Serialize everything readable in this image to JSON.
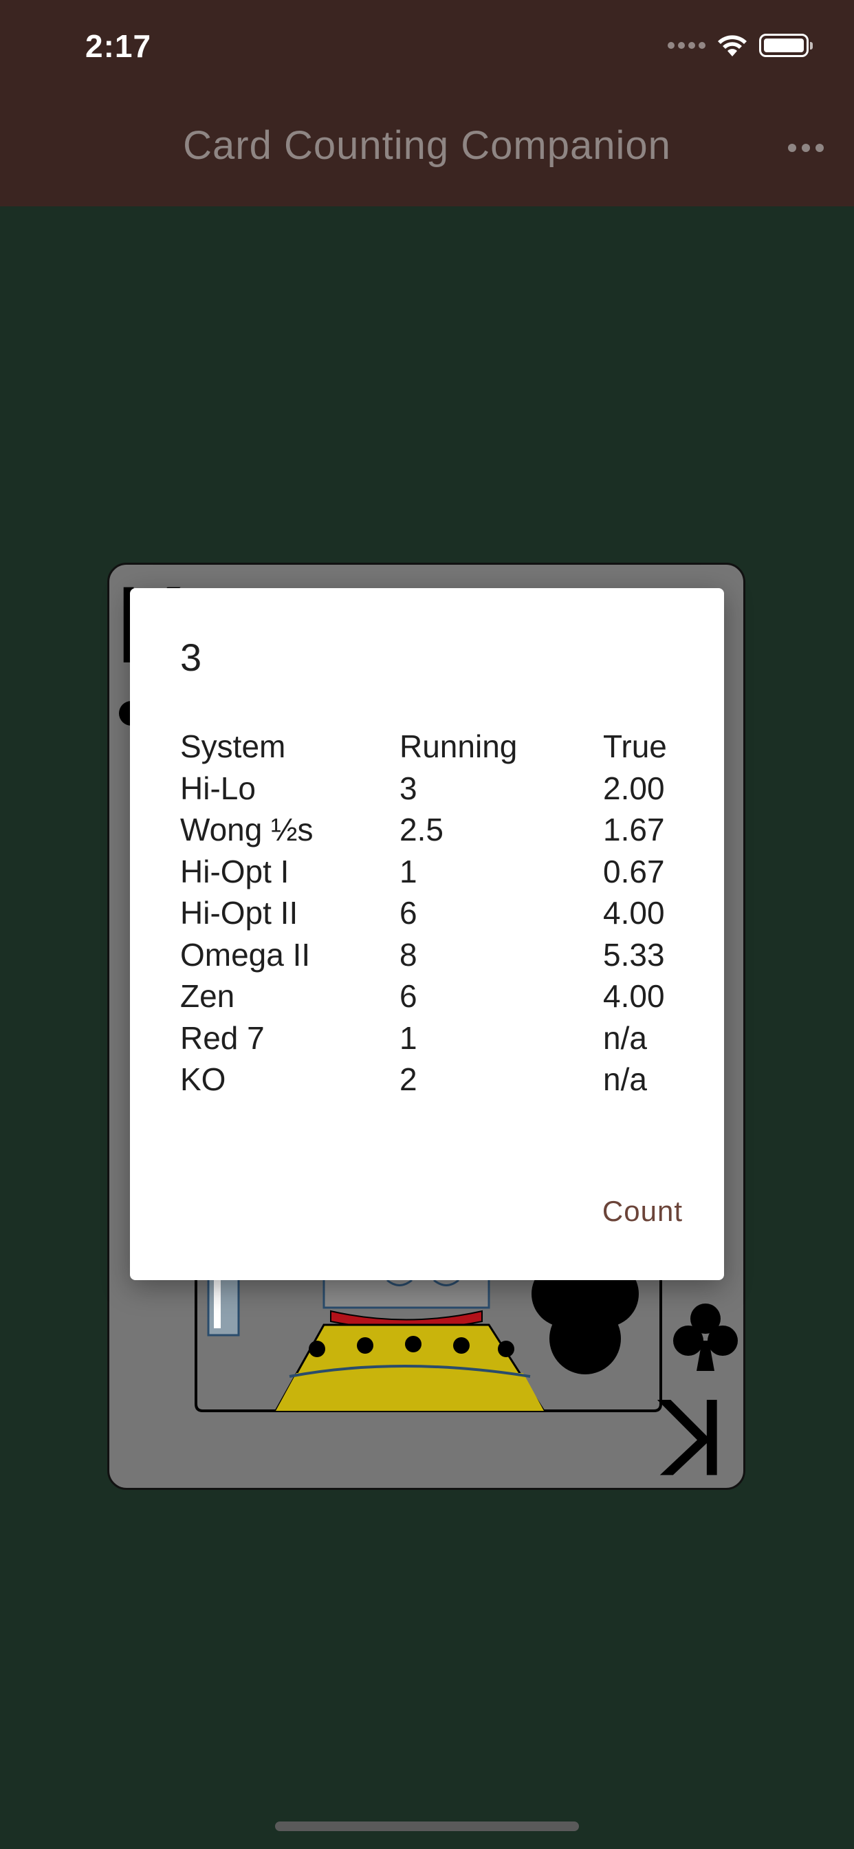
{
  "status_bar": {
    "time": "2:17"
  },
  "app_bar": {
    "title": "Card Counting Companion",
    "more_icon": "more-horizontal-icon"
  },
  "card": {
    "rank": "K",
    "suit": "clubs",
    "suit_icon": "club-icon"
  },
  "dialog": {
    "title": "3",
    "table": {
      "headers": {
        "system": "System",
        "running": "Running",
        "true": "True"
      },
      "rows": [
        {
          "system": "Hi-Lo",
          "running": "3",
          "true": "2.00"
        },
        {
          "system": "Wong ½s",
          "running": "2.5",
          "true": "1.67"
        },
        {
          "system": "Hi-Opt I",
          "running": "1",
          "true": "0.67"
        },
        {
          "system": "Hi-Opt II",
          "running": "6",
          "true": "4.00"
        },
        {
          "system": "Omega II",
          "running": "8",
          "true": "5.33"
        },
        {
          "system": "Zen",
          "running": "6",
          "true": "4.00"
        },
        {
          "system": "Red 7",
          "running": "1",
          "true": "n/a"
        },
        {
          "system": "KO",
          "running": "2",
          "true": "n/a"
        }
      ]
    },
    "action_label": "Count"
  },
  "colors": {
    "app_bar": "#3b2521",
    "background": "#1b2f24",
    "accent": "#6b4439",
    "title_text": "#8f8684"
  }
}
